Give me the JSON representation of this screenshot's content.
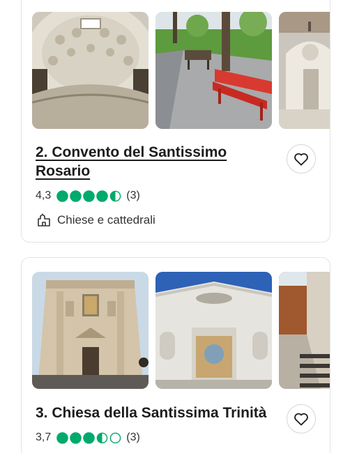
{
  "colors": {
    "rating_green": "#00aa6c",
    "text": "#1c1c1c",
    "border": "#e3e3e3"
  },
  "listings": [
    {
      "title": "2. Convento del Santissimo Rosario",
      "rating_value": "4,3",
      "rating_bubbles": 4.5,
      "review_count": "(3)",
      "category": "Chiese e cattedrali",
      "category_icon": "landmark-icon",
      "save_icon": "heart-icon",
      "photos": [
        "dome-ceiling-photo",
        "garden-bench-photo",
        "church-facade-photo"
      ]
    },
    {
      "title": "3. Chiesa della Santissima Trinità",
      "rating_value": "3,7",
      "rating_bubbles": 3.5,
      "review_count": "(3)",
      "save_icon": "heart-icon",
      "photos": [
        "church-front-photo",
        "church-mosaic-photo",
        "stone-stairs-photo"
      ]
    }
  ]
}
